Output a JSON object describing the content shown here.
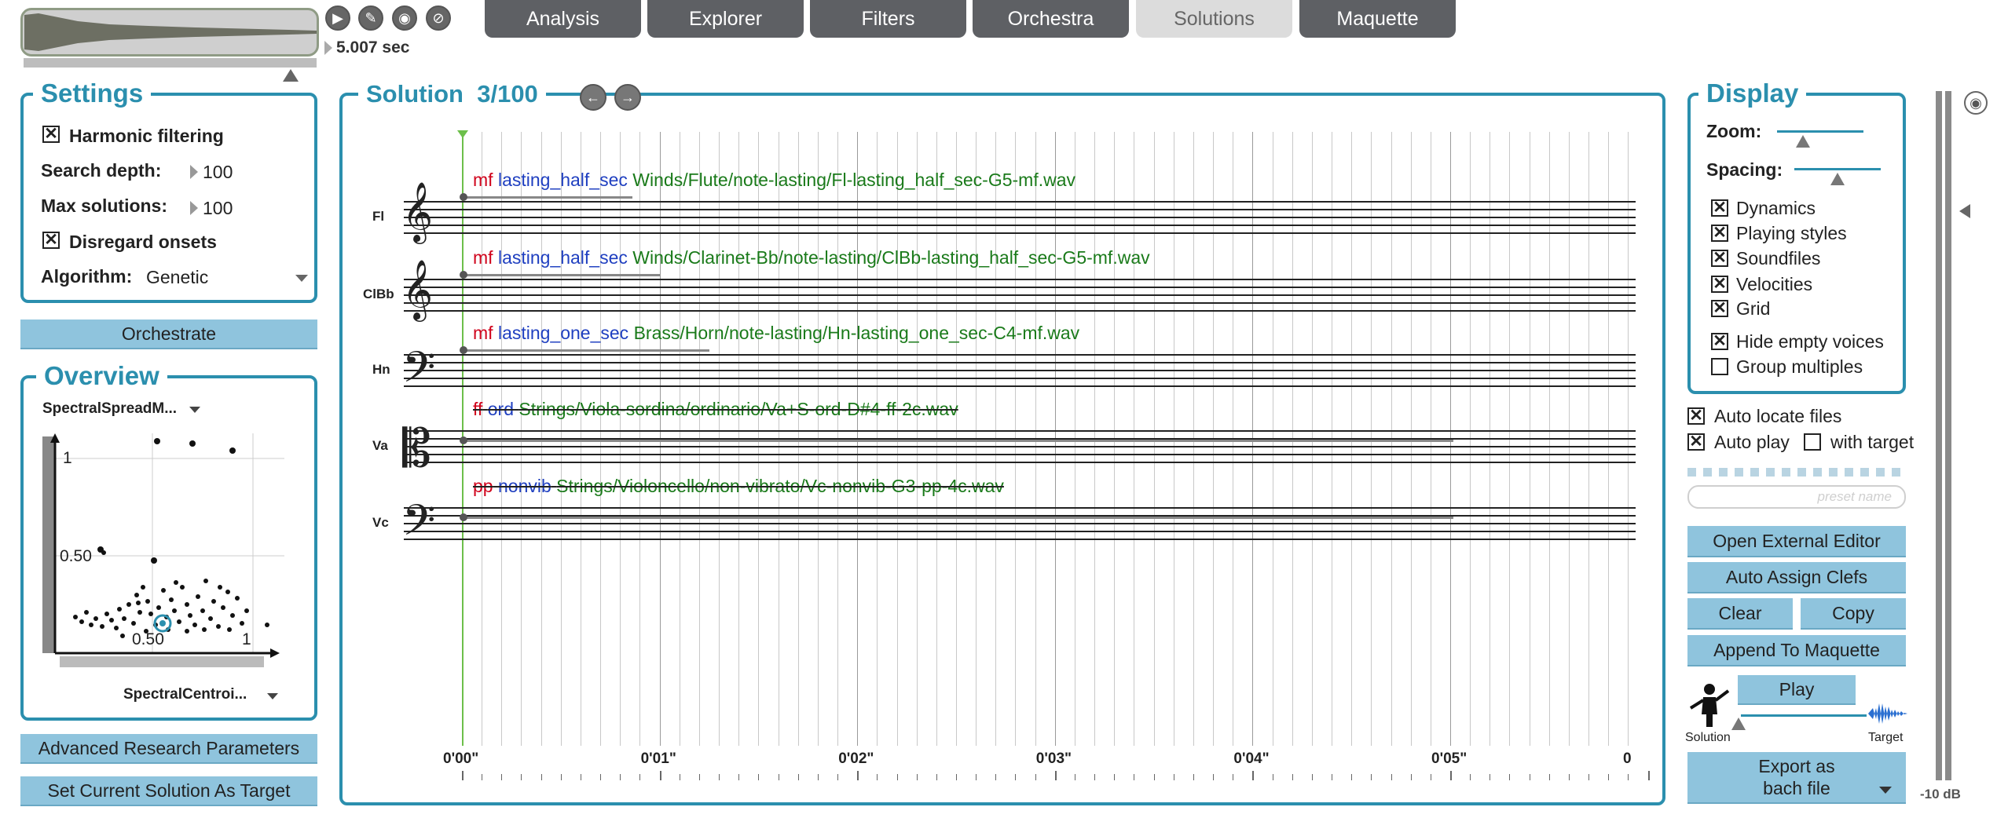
{
  "top": {
    "time": "5.007 sec",
    "transport_icons": [
      "play-icon",
      "pencil-icon",
      "record-icon",
      "stop-icon"
    ],
    "tabs": [
      {
        "label": "Analysis",
        "active": false
      },
      {
        "label": "Explorer",
        "active": false
      },
      {
        "label": "Filters",
        "active": false
      },
      {
        "label": "Orchestra",
        "active": false
      },
      {
        "label": "Solutions",
        "active": true
      },
      {
        "label": "Maquette",
        "active": false
      }
    ]
  },
  "settings": {
    "title": "Settings",
    "harmonic_filtering": {
      "label": "Harmonic filtering",
      "checked": true
    },
    "search_depth": {
      "label": "Search depth:",
      "value": "100"
    },
    "max_solutions": {
      "label": "Max solutions:",
      "value": "100"
    },
    "disregard_onsets": {
      "label": "Disregard onsets",
      "checked": true
    },
    "algorithm": {
      "label": "Algorithm:",
      "value": "Genetic"
    },
    "orchestrate_label": "Orchestrate"
  },
  "overview": {
    "title": "Overview",
    "y_feature": "SpectralSpreadM...",
    "x_feature": "SpectralCentroi...",
    "tick_labels": {
      "y_top": "1",
      "y_mid": "0.50",
      "x_mid": "0.50",
      "x_end": "1"
    },
    "advanced_label": "Advanced Research Parameters",
    "set_target_label": "Set Current Solution As Target"
  },
  "solution": {
    "title": "Solution",
    "counter": "3/100",
    "staves": [
      {
        "instrument": "Fl",
        "clef": "treble",
        "dynamic": "mf",
        "style": "lasting_half_sec",
        "file": "Winds/Flute/note-lasting/Fl-lasting_half_sec-G5-mf.wav"
      },
      {
        "instrument": "ClBb",
        "clef": "treble",
        "dynamic": "mf",
        "style": "lasting_half_sec",
        "file": "Winds/Clarinet-Bb/note-lasting/ClBb-lasting_half_sec-G5-mf.wav"
      },
      {
        "instrument": "Hn",
        "clef": "bass",
        "dynamic": "mf",
        "style": "lasting_one_sec",
        "file": "Brass/Horn/note-lasting/Hn-lasting_one_sec-C4-mf.wav"
      },
      {
        "instrument": "Va",
        "clef": "alto",
        "dynamic": "ff",
        "style": "ord",
        "file": "Strings/Viola-sordina/ordinario/Va+S-ord-D#4-ff-2c.wav"
      },
      {
        "instrument": "Vc",
        "clef": "bass",
        "dynamic": "pp",
        "style": "nonvib",
        "file": "Strings/Violoncello/non-vibrato/Vc-nonvib-G3-pp-4c.wav"
      }
    ],
    "time_labels": [
      "0'00\"",
      "0'01\"",
      "0'02\"",
      "0'03\"",
      "0'04\"",
      "0'05\"",
      "0"
    ]
  },
  "display": {
    "title": "Display",
    "zoom_label": "Zoom:",
    "spacing_label": "Spacing:",
    "options": [
      {
        "label": "Dynamics",
        "checked": true
      },
      {
        "label": "Playing styles",
        "checked": true
      },
      {
        "label": "Soundfiles",
        "checked": true
      },
      {
        "label": "Velocities",
        "checked": true
      },
      {
        "label": "Grid",
        "checked": true
      },
      {
        "label": "Hide empty voices",
        "checked": true
      },
      {
        "label": "Group multiples",
        "checked": false
      }
    ]
  },
  "right": {
    "auto_locate": {
      "label": "Auto locate files",
      "checked": true
    },
    "auto_play": {
      "label": "Auto play",
      "checked": true
    },
    "with_target": {
      "label": "with target",
      "checked": false
    },
    "preset_placeholder": "preset name",
    "open_editor": "Open External Editor",
    "auto_assign": "Auto Assign Clefs",
    "clear": "Clear",
    "copy": "Copy",
    "append": "Append To Maquette",
    "play": "Play",
    "solution_label": "Solution",
    "target_label": "Target",
    "export_line1": "Export as",
    "export_line2": "bach file",
    "meter_label": "-10 dB"
  },
  "colors": {
    "accent": "#2b8fae",
    "button": "#8fc4dd",
    "tab": "#5e6064",
    "dynamic": "#d0021b",
    "style": "#1f3fc0",
    "file": "#1a7a1a"
  }
}
